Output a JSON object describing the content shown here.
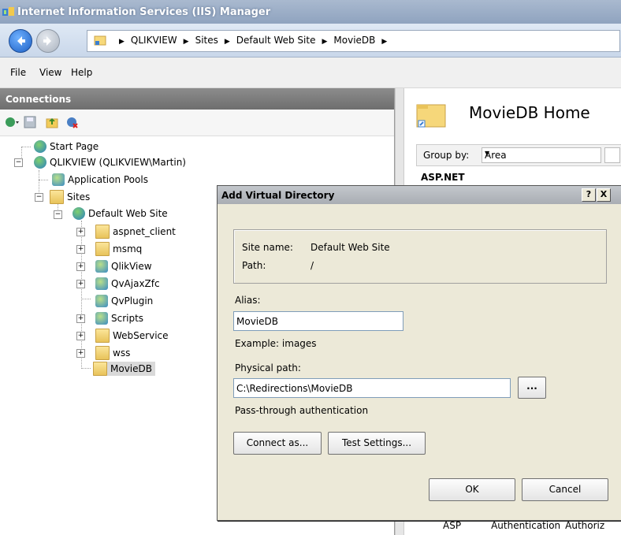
{
  "window": {
    "title": "Internet Information Services (IIS) Manager"
  },
  "address_bar": {
    "crumbs": [
      "QLIKVIEW",
      "Sites",
      "Default Web Site",
      "MovieDB"
    ]
  },
  "menu": {
    "items": [
      "File",
      "View",
      "Help"
    ]
  },
  "connections": {
    "header": "Connections",
    "tree": {
      "start_page": "Start Page",
      "server": "QLIKVIEW (QLIKVIEW\\Martin)",
      "app_pools": "Application Pools",
      "sites": "Sites",
      "default_site": "Default Web Site",
      "children": [
        "aspnet_client",
        "msmq",
        "QlikView",
        "QvAjaxZfc",
        "QvPlugin",
        "Scripts",
        "WebService",
        "wss",
        "MovieDB"
      ]
    }
  },
  "right_pane": {
    "title": "MovieDB Home",
    "group_by_label": "Group by:",
    "group_by_value": "Area",
    "section": "ASP.NET",
    "bottom_items": [
      "ASP",
      "Authentication",
      "Authoriz"
    ]
  },
  "dialog": {
    "title": "Add Virtual Directory",
    "help_btn": "?",
    "close_btn": "X",
    "site_name_label": "Site name:",
    "site_name_value": "Default Web Site",
    "path_label": "Path:",
    "path_value": "/",
    "alias_label": "Alias:",
    "alias_value": "MovieDB",
    "example_text": "Example: images",
    "physical_path_label": "Physical path:",
    "physical_path_value": "C:\\Redirections\\MovieDB",
    "browse_btn": "...",
    "passthrough_text": "Pass-through authentication",
    "connect_as_btn": "Connect as...",
    "test_settings_btn": "Test Settings...",
    "ok_btn": "OK",
    "cancel_btn": "Cancel"
  }
}
